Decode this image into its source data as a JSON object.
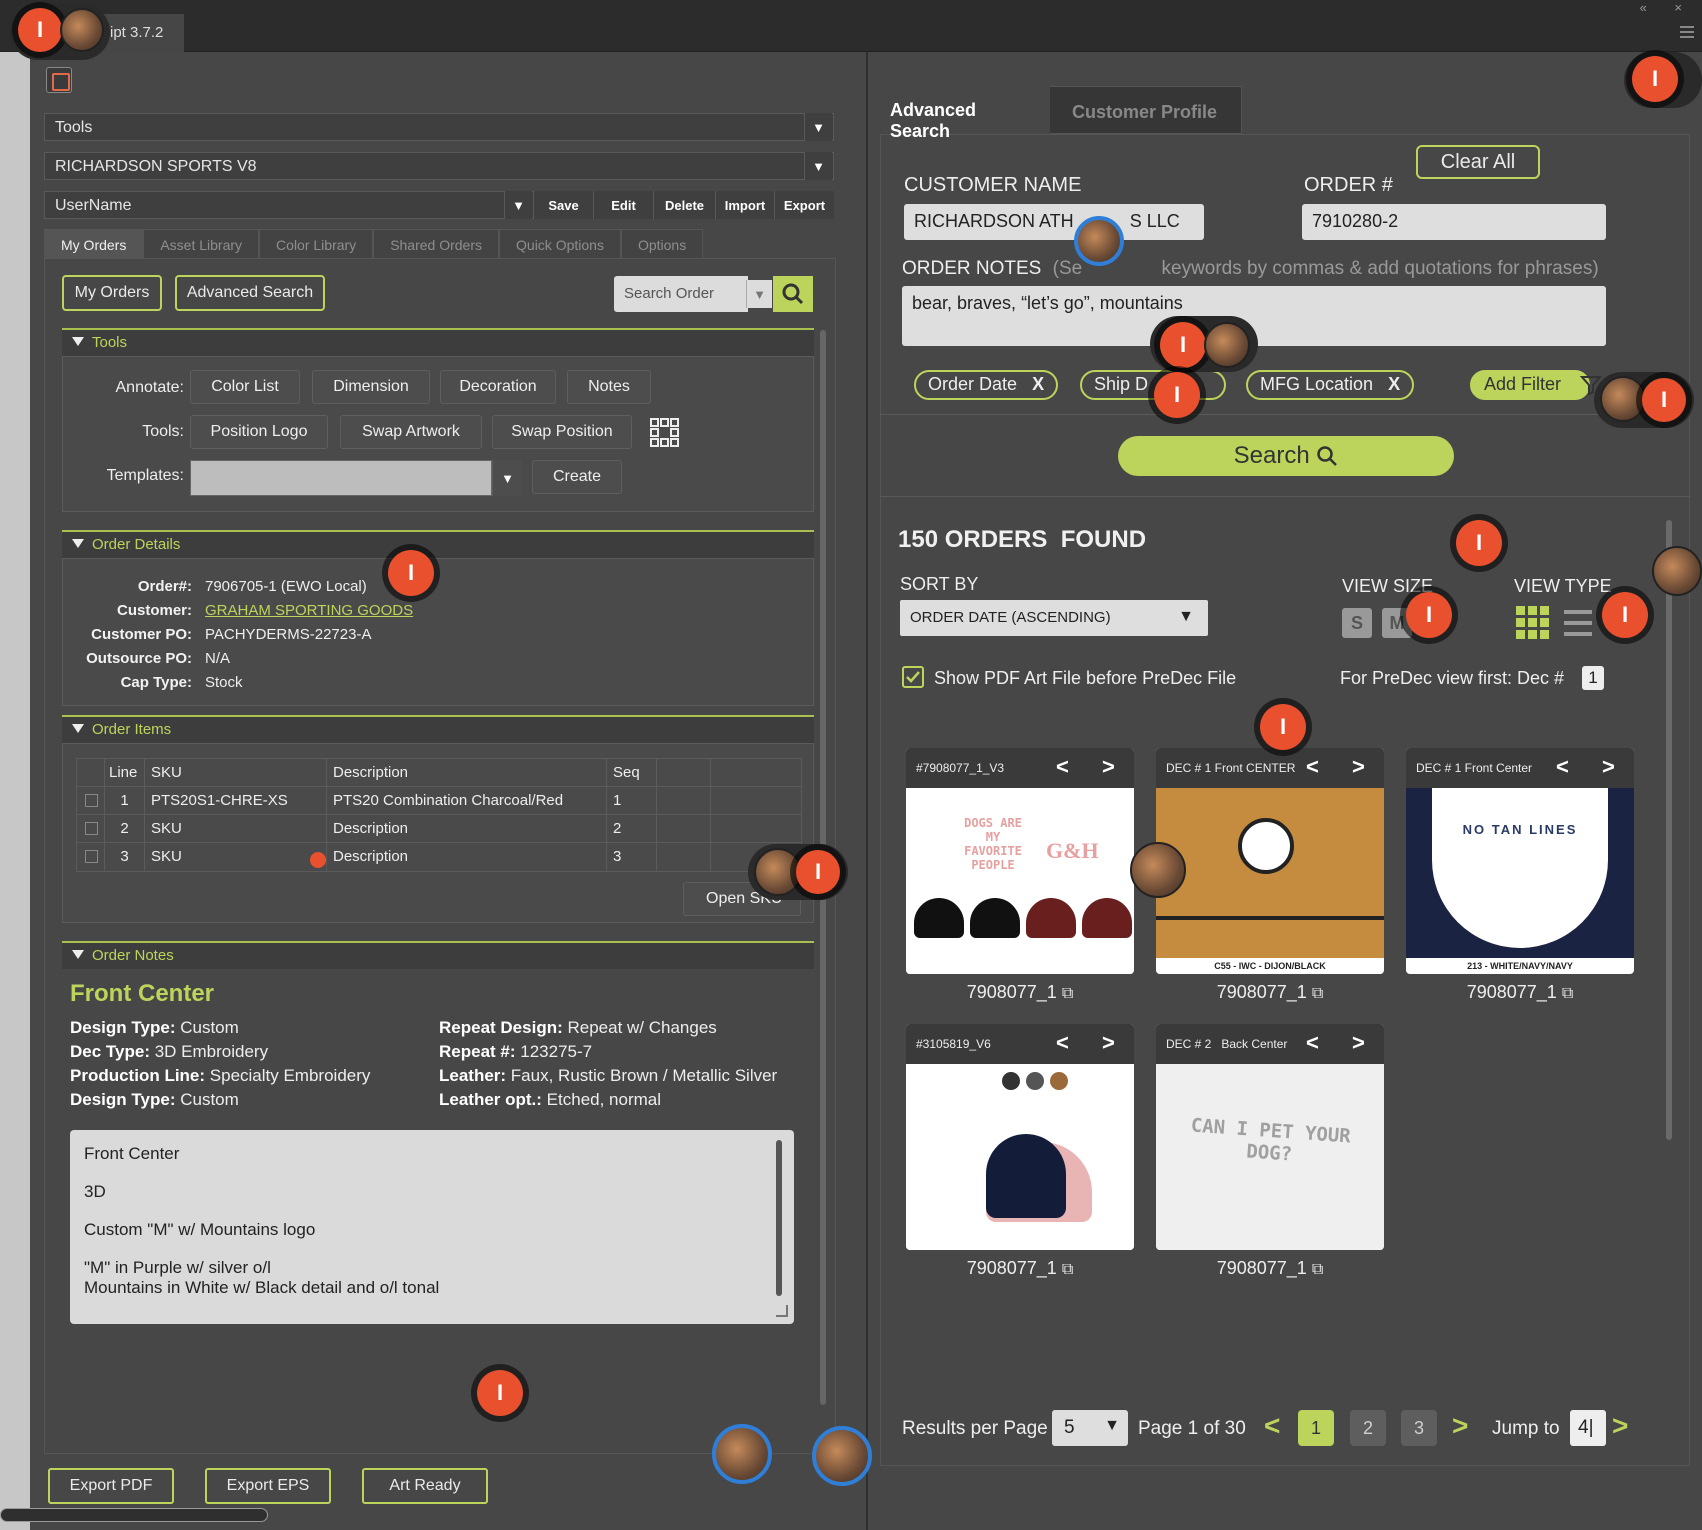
{
  "app": {
    "title": "ipt 3.7.2",
    "window_controls": "« ×"
  },
  "toolbar": {
    "tools_dropdown": "Tools",
    "vendor_dropdown": "RICHARDSON SPORTS V8",
    "user_dropdown": "UserName",
    "save": "Save",
    "edit": "Edit",
    "delete": "Delete",
    "import": "Import",
    "export": "Export"
  },
  "subtabs": [
    "My Orders",
    "Asset Library",
    "Color Library",
    "Shared Orders",
    "Quick Options",
    "Options"
  ],
  "left": {
    "my_orders_btn": "My Orders",
    "advanced_search_btn": "Advanced Search",
    "search_placeholder": "Search Order",
    "tools_section": "Tools",
    "annotate_label": "Annotate:",
    "annotate_buttons": [
      "Color List",
      "Dimension",
      "Decoration",
      "Notes"
    ],
    "tools_label": "Tools:",
    "tools_buttons": [
      "Position Logo",
      "Swap Artwork",
      "Swap Position"
    ],
    "templates_label": "Templates:",
    "create_btn": "Create",
    "order_details_section": "Order Details",
    "order_details": {
      "order_label": "Order#:",
      "order_value": "7906705-1 (EWO Local)",
      "customer_label": "Customer:",
      "customer_value": "GRAHAM SPORTING GOODS",
      "po_label": "Customer PO:",
      "po_value": "PACHYDERMS-22723-A",
      "outsource_label": "Outsource PO:",
      "outsource_value": "N/A",
      "captype_label": "Cap Type:",
      "captype_value": "Stock"
    },
    "order_items_section": "Order Items",
    "items_headers": [
      "Line",
      "SKU",
      "Description",
      "Seq"
    ],
    "items": [
      {
        "line": "1",
        "sku": "PTS20S1-CHRE-XS",
        "desc": "PTS20 Combination Charcoal/Red",
        "seq": "1"
      },
      {
        "line": "2",
        "sku": "SKU",
        "desc": "Description",
        "seq": "2"
      },
      {
        "line": "3",
        "sku": "SKU",
        "desc": "Description",
        "seq": "3"
      }
    ],
    "open_btn": "Open SKU",
    "order_notes_section": "Order Notes",
    "notes_title": "Front Center",
    "notes_left": [
      {
        "k": "Design Type:",
        "v": " Custom"
      },
      {
        "k": "Dec Type:",
        "v": " 3D Embroidery"
      },
      {
        "k": "Production Line:",
        "v": " Specialty Embroidery"
      },
      {
        "k": "Design Type:",
        "v": " Custom"
      }
    ],
    "notes_right": [
      {
        "k": "Repeat Design:",
        "v": " Repeat w/ Changes"
      },
      {
        "k": "Repeat #:",
        "v": " 123275-7"
      },
      {
        "k": "Leather:",
        "v": " Faux, Rustic Brown / Metallic Silver"
      },
      {
        "k": "Leather opt.:",
        "v": " Etched, normal"
      }
    ],
    "note_lines": [
      "Front Center",
      "3D",
      "Custom \"M\" w/ Mountains logo",
      "\"M\" in Purple w/ silver o/l",
      "Mountains in White w/ Black detail and o/l tonal"
    ],
    "export_pdf": "Export PDF",
    "export_eps": "Export EPS",
    "art_ready": "Art Ready"
  },
  "right": {
    "tab_advanced": "Advanced Search",
    "tab_profile": "Customer Profile",
    "clear_all": "Clear All",
    "customer_name_label": "CUSTOMER NAME",
    "customer_name_value": "RICHARDSON ATH",
    "customer_name_tail": "S LLC",
    "order_label": "ORDER #",
    "order_value": "7910280-2",
    "notes_label": "ORDER NOTES",
    "notes_hint_a": "(Se",
    "notes_hint_b": "keywords by commas & add quotations for phrases)",
    "notes_value": "bear, braves, “let’s go”, mountains",
    "filters": [
      "Order Date",
      "Ship D",
      "MFG Location"
    ],
    "add_filter": "Add Filter",
    "search_btn": "Search",
    "found": "150 ORDERS  FOUND",
    "sort_label": "SORT BY",
    "sort_value": "ORDER DATE (ASCENDING)",
    "view_size_label": "VIEW SIZE",
    "view_size_s": "S",
    "view_size_m": "M",
    "view_type_label": "VIEW TYPE",
    "pdf_checkbox": "Show PDF Art File before PreDec File",
    "predec_label": "For PreDec view first: Dec #",
    "predec_value": "1",
    "thumbs": [
      {
        "head": "#7908077_1_V3",
        "label": "7908077_1",
        "caption": ""
      },
      {
        "head": "DEC # 1 Front CENTER",
        "label": "7908077_1",
        "caption": "C55 - IWC - DIJON/BLACK"
      },
      {
        "head": "DEC # 1 Front Center",
        "label": "7908077_1",
        "caption": "213 - WHITE/NAVY/NAVY"
      },
      {
        "head": "#3105819_V6",
        "label": "7908077_1",
        "caption": ""
      },
      {
        "head": "DEC # 2   Back Center",
        "label": "7908077_1",
        "caption": ""
      }
    ],
    "thumb_art": {
      "dogs_text": "DOGS ARE MY FAVORITE PEOPLE",
      "gh_text": "G&H",
      "tanlines_text": "NO TAN LINES",
      "petdog_text": "CAN I PET YOUR DOG?"
    },
    "results_label": "Results per Page",
    "results_value": "5",
    "page_label": "Page 1 of 30",
    "pages": [
      "1",
      "2",
      "3"
    ],
    "jump_label": "Jump to",
    "jump_value": "4|"
  },
  "colors": {
    "accent": "#bcd45c",
    "badge": "#e8502e",
    "panel": "#474747"
  }
}
